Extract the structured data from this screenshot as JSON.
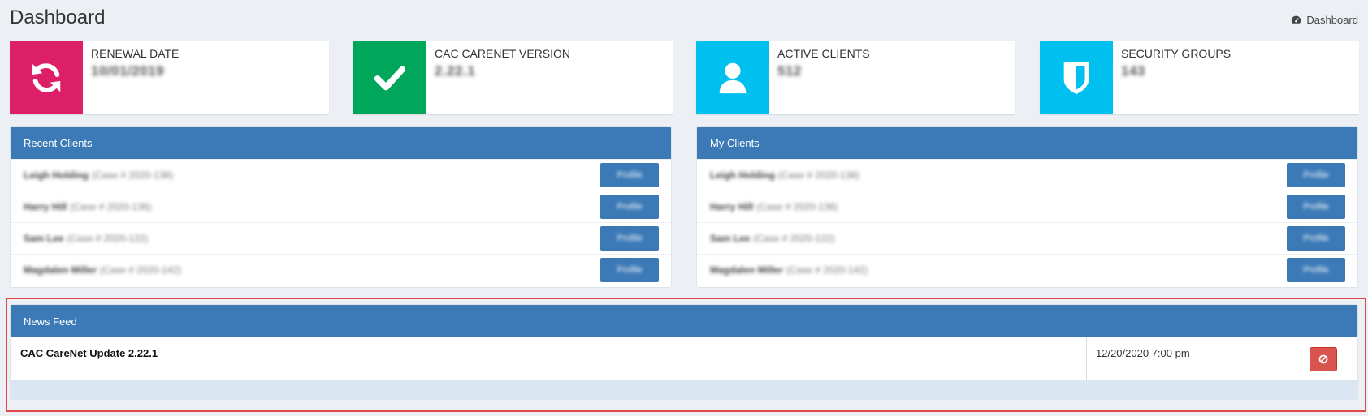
{
  "header": {
    "title": "Dashboard",
    "breadcrumb_label": "Dashboard",
    "breadcrumb_icon": "dashboard-icon"
  },
  "info_boxes": [
    {
      "label": "RENEWAL DATE",
      "value": "10/01/2019",
      "color": "#dd1f68",
      "icon": "refresh-icon"
    },
    {
      "label": "CAC CARENET VERSION",
      "value": "2.22.1",
      "color": "#00a65a",
      "icon": "check-icon"
    },
    {
      "label": "ACTIVE CLIENTS",
      "value": "512",
      "color": "#00c0ef",
      "icon": "user-icon"
    },
    {
      "label": "SECURITY GROUPS",
      "value": "143",
      "color": "#00c0ef",
      "icon": "shield-icon"
    }
  ],
  "recent_clients": {
    "title": "Recent Clients",
    "button_label": "Profile",
    "rows": [
      {
        "name": "Leigh Holding",
        "case": "(Case # 2020-138)"
      },
      {
        "name": "Harry Hill",
        "case": "(Case # 2020-136)"
      },
      {
        "name": "Sam Lee",
        "case": "(Case # 2020-122)"
      },
      {
        "name": "Magdalen Miller",
        "case": "(Case # 2020-142)"
      }
    ]
  },
  "my_clients": {
    "title": "My Clients",
    "button_label": "Profile",
    "rows": [
      {
        "name": "Leigh Holding",
        "case": "(Case # 2020-138)"
      },
      {
        "name": "Harry Hill",
        "case": "(Case # 2020-136)"
      },
      {
        "name": "Sam Lee",
        "case": "(Case # 2020-122)"
      },
      {
        "name": "Magdalen Miller",
        "case": "(Case # 2020-142)"
      }
    ]
  },
  "news_feed": {
    "title": "News Feed",
    "items": [
      {
        "title": "CAC CareNet Update 2.22.1",
        "date": "12/20/2020 7:00 pm",
        "action_icon": "ban-icon"
      }
    ]
  },
  "colors": {
    "panel_header": "#3c7ab7",
    "highlight": "#e04848",
    "danger": "#d9534f"
  }
}
